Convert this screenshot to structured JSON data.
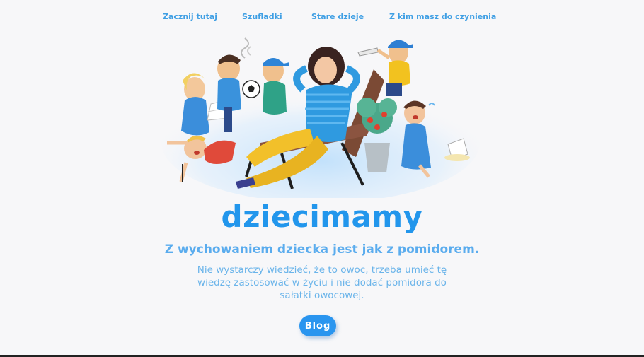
{
  "nav": {
    "items": [
      {
        "label": "Zacznij tutaj"
      },
      {
        "label": "Szufladki"
      },
      {
        "label": "Stare dzieje"
      },
      {
        "label": "Z kim masz do czynienia"
      }
    ]
  },
  "hero": {
    "brand": "dziecimamy",
    "tagline": "Z wychowaniem dziecka jest jak z pomidorem.",
    "description": "Nie wystarczy wiedzieć, że to owoc, trzeba umieć tę wiedzę zastosować w życiu i nie dodać pomidora do sałatki owocowej.",
    "button_label": "Blog"
  },
  "colors": {
    "accent": "#2296ec",
    "nav_link": "#3f9fe4",
    "background": "#f7f7f9"
  }
}
